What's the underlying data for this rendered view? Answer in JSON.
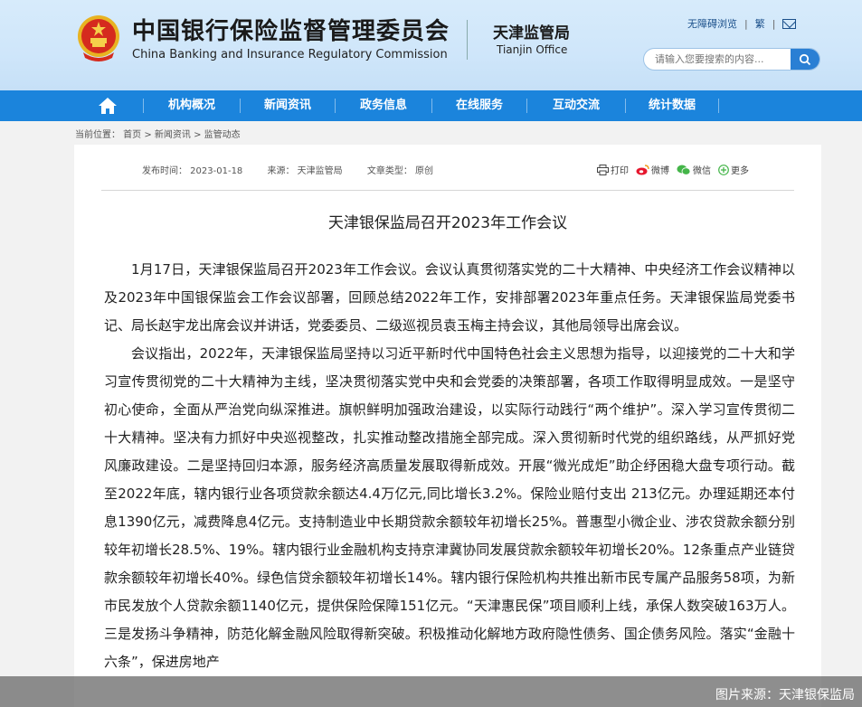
{
  "header": {
    "title_cn": "中国银行保险监督管理委员会",
    "title_en": "China Banking and Insurance Regulatory Commission",
    "office_cn": "天津监管局",
    "office_en": "Tianjin Office",
    "top_links": [
      "无障碍浏览",
      "繁"
    ],
    "search_placeholder": "请输入您要搜索的内容..."
  },
  "nav": {
    "items": [
      "机构概况",
      "新闻资讯",
      "政务信息",
      "在线服务",
      "互动交流",
      "统计数据"
    ]
  },
  "breadcrumb": "当前位置： 首页 > 新闻资讯 > 监管动态",
  "article": {
    "date": "发布时间： 2023-01-18",
    "source": "来源： 天津监管局",
    "type": "文章类型： 原创",
    "share": {
      "print": "打印",
      "weibo": "微博",
      "wechat": "微信",
      "more": "更多"
    },
    "title": "天津银保监局召开2023年工作会议",
    "paragraphs": [
      "1月17日，天津银保监局召开2023年工作会议。会议认真贯彻落实党的二十大精神、中央经济工作会议精神以及2023年中国银保监会工作会议部署，回顾总结2022年工作，安排部署2023年重点任务。天津银保监局党委书记、局长赵宇龙出席会议并讲话，党委委员、二级巡视员袁玉梅主持会议，其他局领导出席会议。",
      "会议指出，2022年，天津银保监局坚持以习近平新时代中国特色社会主义思想为指导，以迎接党的二十大和学习宣传贯彻党的二十大精神为主线，坚决贯彻落实党中央和会党委的决策部署，各项工作取得明显成效。一是坚守初心使命，全面从严治党向纵深推进。旗帜鲜明加强政治建设，以实际行动践行“两个维护”。深入学习宣传贯彻二十大精神。坚决有力抓好中央巡视整改，扎实推动整改措施全部完成。深入贯彻新时代党的组织路线，从严抓好党风廉政建设。二是坚持回归本源，服务经济高质量发展取得新成效。开展“微光成炬”助企纾困稳大盘专项行动。截至2022年底，辖内银行业各项贷款余额达4.4万亿元,同比增长3.2%。保险业赔付支出 213亿元。办理延期还本付息1390亿元，减费降息4亿元。支持制造业中长期贷款余额较年初增长25%。普惠型小微企业、涉农贷款余额分别较年初增长28.5%、19%。辖内银行业金融机构支持京津冀协同发展贷款余额较年初增长20%。12条重点产业链贷款余额较年初增长40%。绿色信贷余额较年初增长14%。辖内银行保险机构共推出新市民专属产品服务58项，为新市民发放个人贷款余额1140亿元，提供保险保障151亿元。“天津惠民保”项目顺利上线，承保人数突破163万人。三是发扬斗争精神，防范化解金融风险取得新突破。积极推动化解地方政府隐性债务、国企债务风险。落实“金融十六条”，保进房地产"
    ]
  },
  "photo_credit": "图片来源：天津银保监局",
  "colors": {
    "nav_blue": "#1b84dc",
    "header_bg": "#cfe6fa"
  }
}
